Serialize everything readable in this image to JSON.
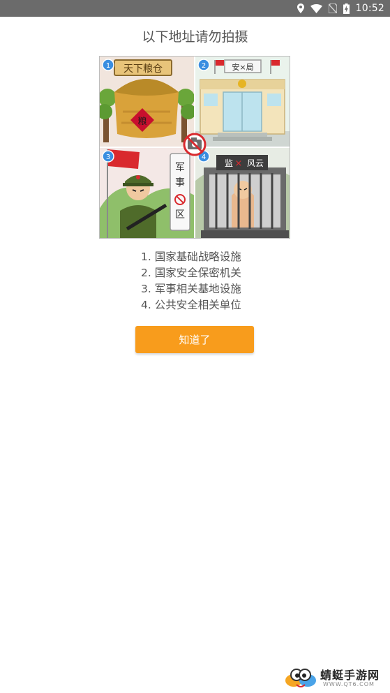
{
  "status_bar": {
    "time": "10:52",
    "icons": [
      "location-icon",
      "wifi-icon",
      "no-sim-icon",
      "battery-charging-icon"
    ]
  },
  "title": "以下地址请勿拍摄",
  "illustration": {
    "panels": [
      {
        "number": "1",
        "sign": "天下粮仓",
        "badge": "粮"
      },
      {
        "number": "2",
        "sign": "安×局"
      },
      {
        "number": "3",
        "sign_chars": [
          "军",
          "事",
          "区"
        ]
      },
      {
        "number": "4",
        "sign_left": "监",
        "sign_mark": "×",
        "sign_right": "风云"
      }
    ],
    "center_icon": "no-camera-icon"
  },
  "rules": [
    "1. 国家基础战略设施",
    "2. 国家安全保密机关",
    "3. 军事相关基地设施",
    "4. 公共安全相关单位"
  ],
  "confirm_button": {
    "label": "知道了"
  },
  "watermark": {
    "brand": "蜻蜓手游网",
    "url": "WWW.QT6.COM"
  },
  "colors": {
    "accent": "#f89c1c",
    "status_bar": "#6b6b6b",
    "text": "#555555"
  }
}
